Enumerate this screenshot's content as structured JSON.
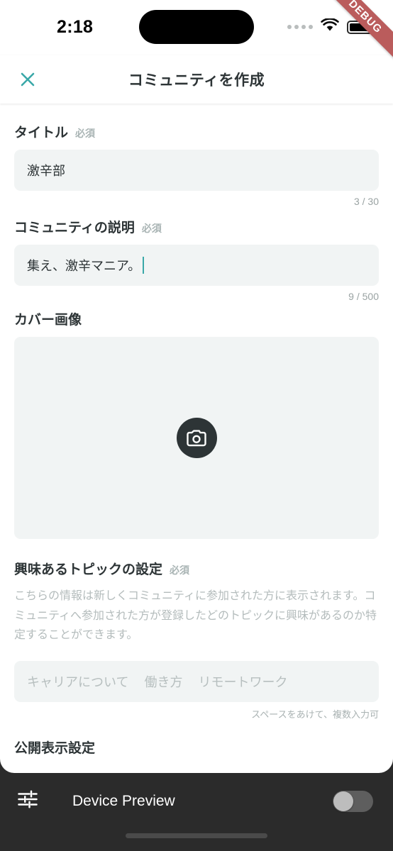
{
  "status_bar": {
    "time": "2:18",
    "cellular_icon": "cellular-dots-icon",
    "wifi_icon": "wifi-icon",
    "battery_icon": "battery-full-icon"
  },
  "debug_ribbon": {
    "label": "DEBUG",
    "color": "#ba5c5c"
  },
  "header": {
    "close_icon": "close-icon",
    "title": "コミュニティを作成",
    "accent_color": "#3aa8a8"
  },
  "form": {
    "title_field": {
      "label": "タイトル",
      "required_badge": "必須",
      "value": "激辛部",
      "counter": "3 / 30"
    },
    "description_field": {
      "label": "コミュニティの説明",
      "required_badge": "必須",
      "value": "集え、激辛マニア。",
      "counter": "9 / 500",
      "has_caret": true
    },
    "cover_image": {
      "label": "カバー画像",
      "camera_icon": "camera-icon",
      "circle_color": "#2d3436"
    },
    "topics_field": {
      "label": "興味あるトピックの設定",
      "required_badge": "必須",
      "description": "こちらの情報は新しくコミュニティに参加された方に表示されます。コミュニティへ参加された方が登録したどのトピックに興味があるのか特定することができます。",
      "placeholder_tags": [
        "キャリアについて",
        "働き方",
        "リモートワーク"
      ],
      "helper": "スペースをあけて、複数入力可"
    },
    "visibility_section": {
      "label": "公開表示設定"
    }
  },
  "bottom_bar": {
    "tune_icon": "sliders-icon",
    "label": "Device Preview",
    "toggle_state": "off"
  }
}
